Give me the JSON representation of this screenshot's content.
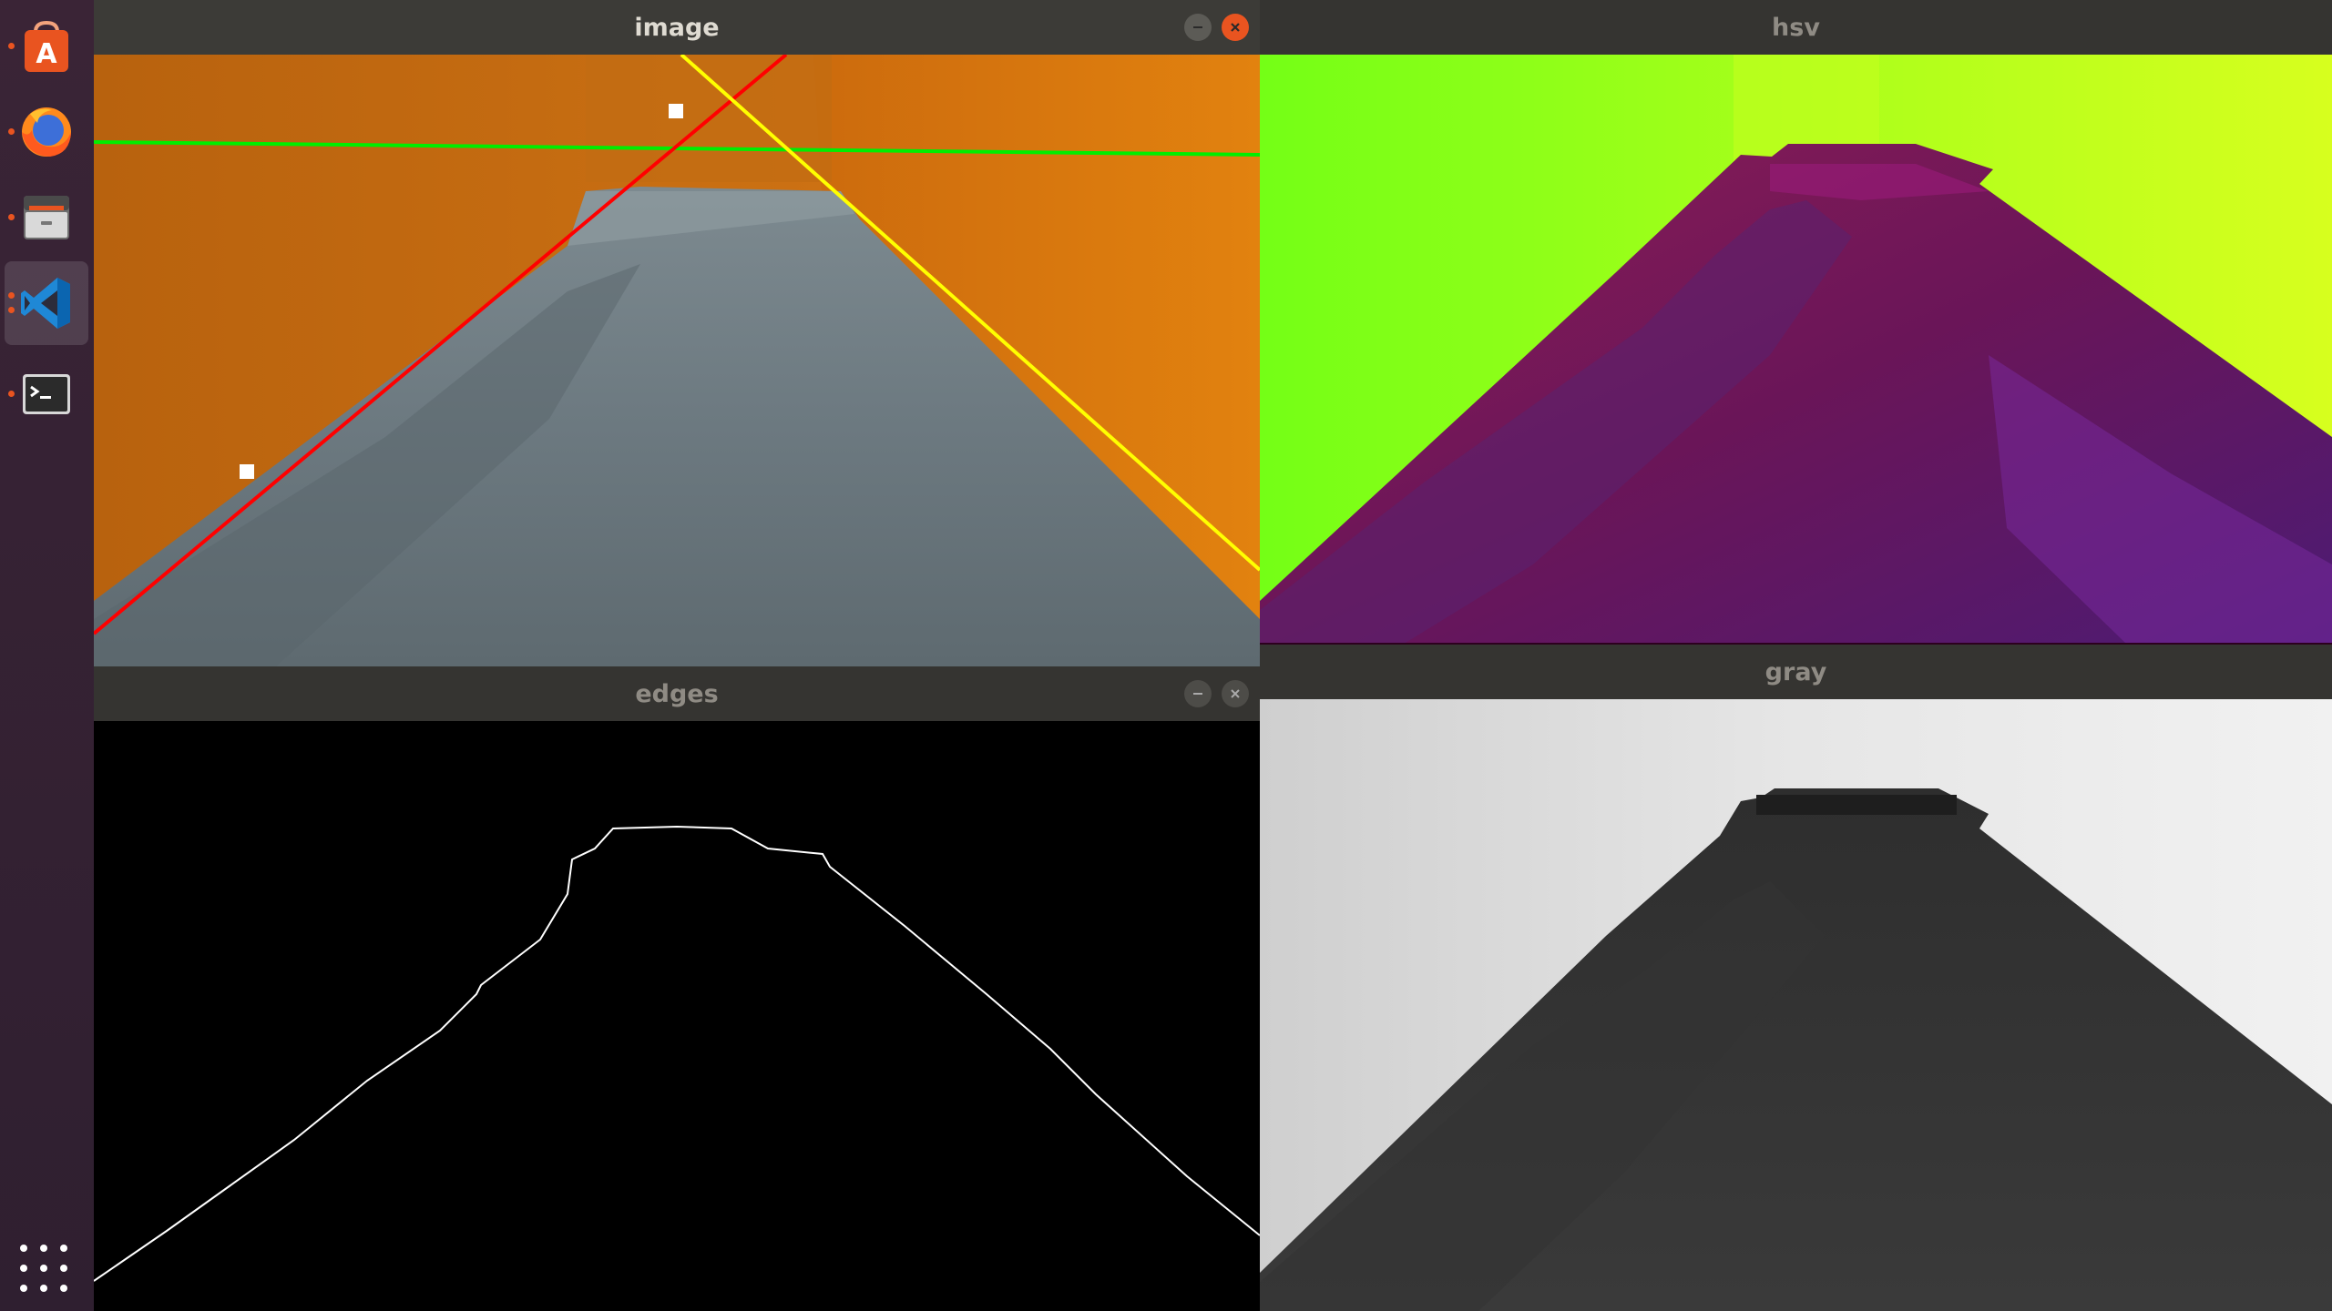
{
  "dock": {
    "items": [
      {
        "name": "Ubuntu Software",
        "icon": "ubuntu-software-icon"
      },
      {
        "name": "Firefox Web Browser",
        "icon": "firefox-icon"
      },
      {
        "name": "Files",
        "icon": "files-icon"
      },
      {
        "name": "Visual Studio Code",
        "icon": "vscode-icon"
      },
      {
        "name": "Terminal",
        "icon": "terminal-icon"
      }
    ],
    "apps_icon": "show-applications-icon"
  },
  "windows": {
    "image": {
      "title": "image"
    },
    "hsv": {
      "title": "hsv"
    },
    "edges": {
      "title": "edges"
    },
    "gray": {
      "title": "gray"
    }
  },
  "colors": {
    "accent": "#e95420",
    "titlebar": "#3c3b37",
    "line_red": "#ff0000",
    "line_green": "#00ff00",
    "line_yellow": "#ffff00",
    "hsv_wall": "#7fff14",
    "hsv_floor": "#6b1460"
  }
}
